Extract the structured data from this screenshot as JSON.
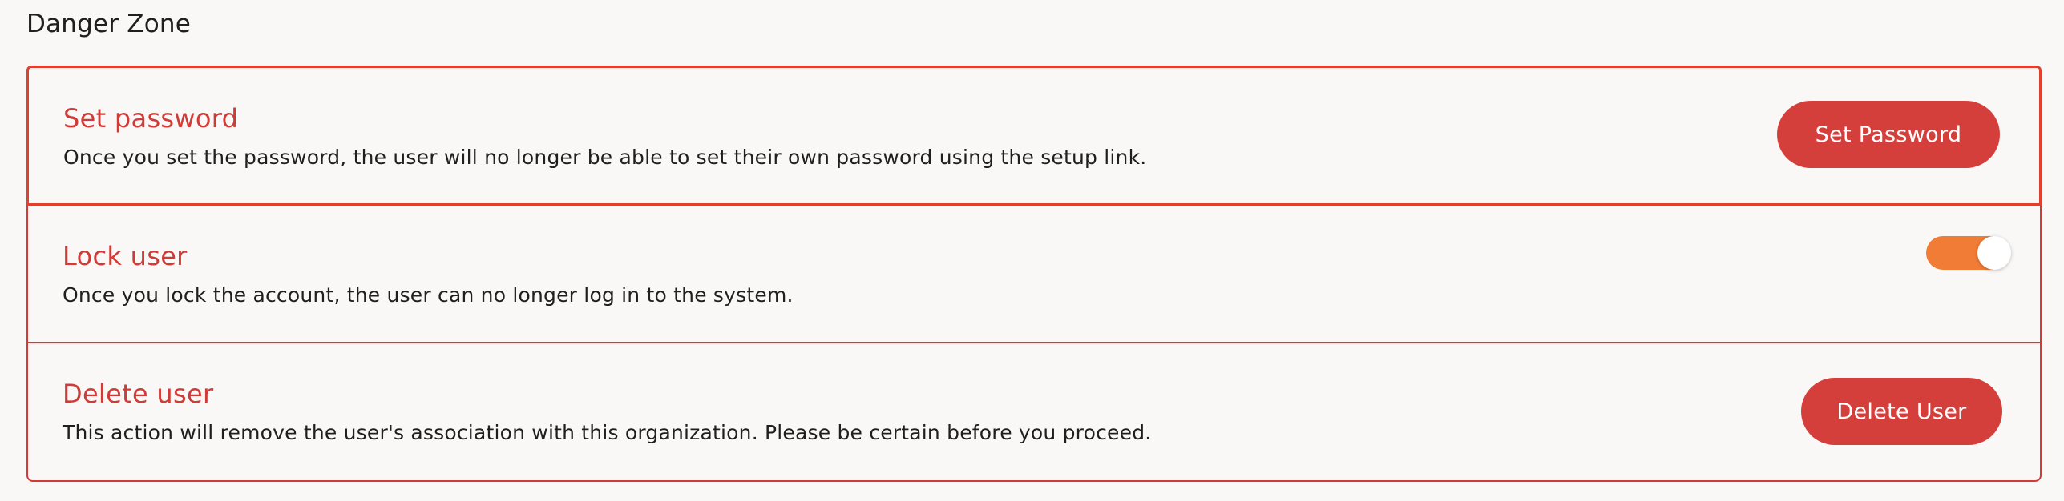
{
  "section": {
    "title": "Danger Zone"
  },
  "rows": [
    {
      "title": "Set password",
      "description": "Once you set the password, the user will no longer be able to set their own password using the setup link.",
      "action_label": "Set Password"
    },
    {
      "title": "Lock user",
      "description": "Once you lock the account, the user can no longer log in to the system.",
      "toggle_on": true
    },
    {
      "title": "Delete user",
      "description": "This action will remove the user's association with this organization. Please be certain before you proceed.",
      "action_label": "Delete User"
    }
  ],
  "colors": {
    "danger": "#d43f3c",
    "toggle_on": "#f07c35",
    "background": "#f9f8f7"
  }
}
